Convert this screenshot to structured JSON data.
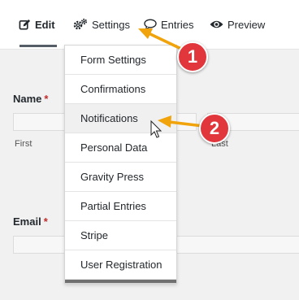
{
  "tabs": {
    "edit": "Edit",
    "settings": "Settings",
    "entries": "Entries",
    "preview": "Preview"
  },
  "form": {
    "name_label": "Name",
    "email_label": "Email",
    "required_mark": "*",
    "first_label": "First",
    "last_label": "Last"
  },
  "settings_menu": [
    "Form Settings",
    "Confirmations",
    "Notifications",
    "Personal Data",
    "Gravity Press",
    "Partial Entries",
    "Stripe",
    "User Registration"
  ],
  "annotations": {
    "step1": "1",
    "step2": "2"
  },
  "colors": {
    "badge": "#e1363c",
    "arrow": "#f0a30a"
  }
}
